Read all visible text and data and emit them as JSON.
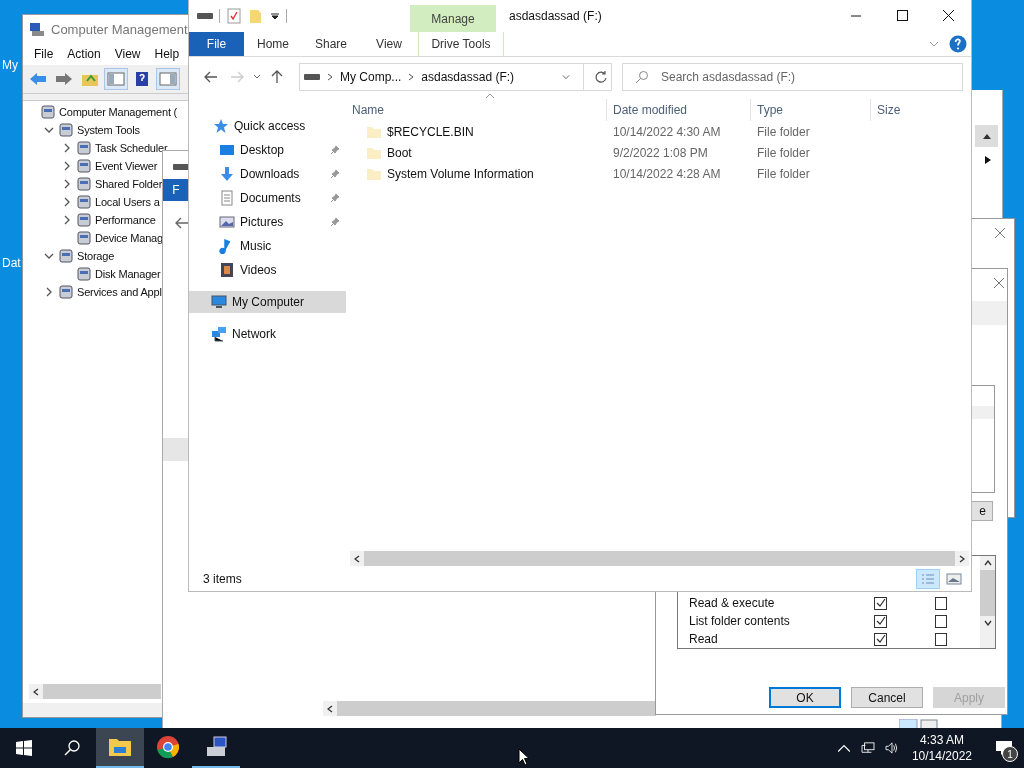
{
  "desktop_icons": [
    {
      "label": "My"
    },
    {
      "label": "Dat"
    }
  ],
  "computer_management": {
    "title": "Computer Management",
    "menu": [
      "File",
      "Action",
      "View",
      "Help"
    ],
    "tree": [
      {
        "label": "Computer Management (",
        "children": [
          {
            "label": "System Tools",
            "expanded": true,
            "children": [
              {
                "label": "Task Scheduler",
                "expanded": false
              },
              {
                "label": "Event Viewer",
                "expanded": false
              },
              {
                "label": "Shared Folder",
                "expanded": false
              },
              {
                "label": "Local Users a",
                "expanded": false
              },
              {
                "label": "Performance",
                "expanded": false
              },
              {
                "label": "Device Manag"
              }
            ]
          },
          {
            "label": "Storage",
            "expanded": true,
            "children": [
              {
                "label": "Disk Manager"
              }
            ]
          },
          {
            "label": "Services and Appl",
            "expanded": false
          }
        ]
      }
    ]
  },
  "background_window": {
    "file_tab": "F"
  },
  "permissions_dialog": {
    "side_button": "e",
    "permissions": [
      {
        "name": "Read & execute",
        "allow": true,
        "deny": false
      },
      {
        "name": "List folder contents",
        "allow": true,
        "deny": false
      },
      {
        "name": "Read",
        "allow": true,
        "deny": false
      }
    ],
    "buttons": [
      {
        "label": "OK",
        "kind": "default"
      },
      {
        "label": "Cancel",
        "kind": "normal"
      },
      {
        "label": "Apply",
        "kind": "disabled"
      }
    ]
  },
  "explorer": {
    "title": "asdasdassad (F:)",
    "context_group": "Manage",
    "ribbon_tabs": [
      {
        "label": "File",
        "kind": "file"
      },
      {
        "label": "Home",
        "kind": "tab"
      },
      {
        "label": "Share",
        "kind": "tab"
      },
      {
        "label": "View",
        "kind": "tab"
      },
      {
        "label": "Drive Tools",
        "kind": "context"
      }
    ],
    "address": [
      "My Comp...",
      "asdasdassad (F:)"
    ],
    "search": {
      "placeholder": "Search asdasdassad (F:)"
    },
    "nav": [
      {
        "label": "Quick access",
        "selected": false,
        "pinned": false
      },
      {
        "label": "Desktop",
        "selected": false,
        "pinned": true
      },
      {
        "label": "Downloads",
        "selected": false,
        "pinned": true
      },
      {
        "label": "Documents",
        "selected": false,
        "pinned": true
      },
      {
        "label": "Pictures",
        "selected": false,
        "pinned": true
      },
      {
        "label": "Music",
        "selected": false,
        "pinned": false
      },
      {
        "label": "Videos",
        "selected": false,
        "pinned": false
      },
      {
        "label": "My Computer",
        "selected": true,
        "pinned": false
      },
      {
        "label": "Network",
        "selected": false,
        "pinned": false
      }
    ],
    "columns": [
      "Name",
      "Date modified",
      "Type",
      "Size"
    ],
    "rows": [
      {
        "name": "$RECYCLE.BIN",
        "date": "10/14/2022 4:30 AM",
        "type": "File folder"
      },
      {
        "name": "Boot",
        "date": "9/2/2022 1:08 PM",
        "type": "File folder"
      },
      {
        "name": "System Volume Information",
        "date": "10/14/2022 4:28 AM",
        "type": "File folder"
      }
    ],
    "status": "3 items"
  },
  "taskbar": {
    "apps": [
      {
        "kind": "explorer",
        "selected": true,
        "running": true
      },
      {
        "kind": "chrome",
        "selected": false,
        "running": false
      },
      {
        "kind": "compmgmt",
        "selected": false,
        "running": true
      }
    ],
    "time": "4:33 AM",
    "date": "10/14/2022",
    "notifications": "1"
  }
}
